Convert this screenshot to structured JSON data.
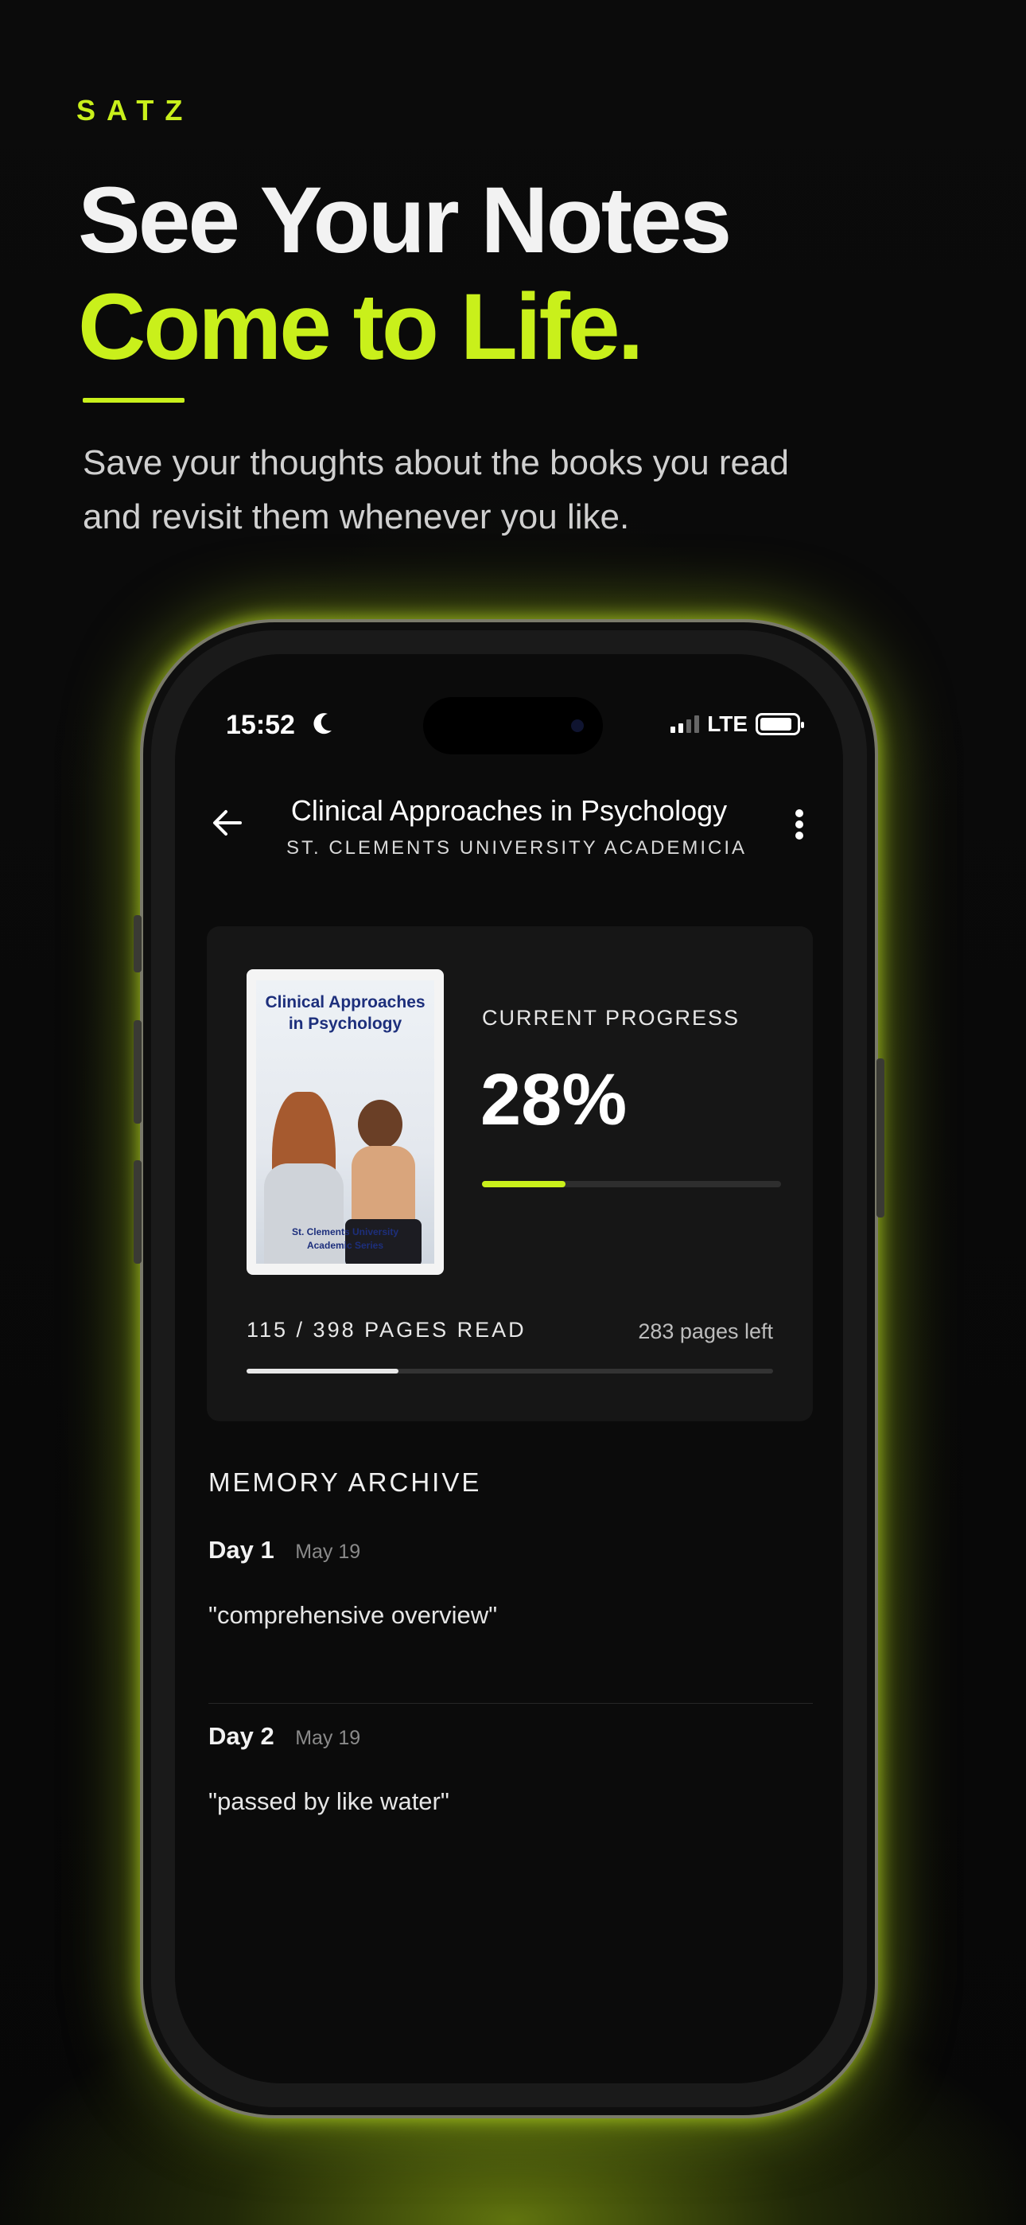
{
  "brand": "SATZ",
  "headline": {
    "line1": "See Your Notes",
    "line2": "Come to Life."
  },
  "subtitle": {
    "line1": "Save your thoughts about the books you read",
    "line2": "and revisit them whenever you like."
  },
  "colors": {
    "accent": "#c9f01b",
    "background": "#0b0b0b",
    "card": "#161616",
    "cover_title": "#1d2f7c"
  },
  "status_bar": {
    "time": "15:52",
    "network": "LTE",
    "icons": [
      "moon-icon",
      "signal-icon",
      "battery-icon"
    ]
  },
  "nav": {
    "title": "Clinical Approaches in Psychology",
    "subtitle": "ST. CLEMENTS UNIVERSITY ACADEMICIAN ...",
    "back_icon": "arrow-left-icon",
    "more_icon": "more-vertical-icon"
  },
  "book": {
    "cover_title": "Clinical Approaches in Psychology",
    "cover_footer_line1": "St. Clements University",
    "cover_footer_line2": "Academic Series"
  },
  "progress": {
    "label": "CURRENT PROGRESS",
    "percent_text": "28%",
    "percent": 0.28,
    "pages_read_text": "115 / 398 PAGES READ",
    "pages_left_text": "283 pages left",
    "pages_read": 115,
    "pages_total": 398
  },
  "archive": {
    "title": "MEMORY ARCHIVE",
    "entries": [
      {
        "day": "Day 1",
        "date": "May 19",
        "quote": "\"comprehensive overview\""
      },
      {
        "day": "Day 2",
        "date": "May 19",
        "quote": "\"passed by like water\""
      }
    ]
  }
}
